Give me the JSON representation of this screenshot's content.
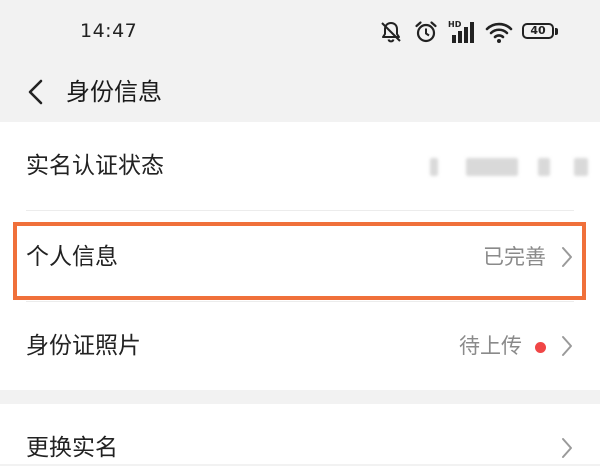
{
  "status_bar": {
    "time": "14:47",
    "battery_level": "40",
    "network_badge": "HD",
    "icons": [
      "bell-muted-icon",
      "alarm-icon",
      "signal-icon",
      "wifi-icon",
      "battery-icon"
    ]
  },
  "header": {
    "title": "身份信息"
  },
  "rows": [
    {
      "label": "实名认证状态",
      "value": ""
    },
    {
      "label": "个人信息",
      "value": "已完善"
    },
    {
      "label": "身份证照片",
      "value": "待上传"
    },
    {
      "label": "更换实名",
      "value": ""
    }
  ],
  "colors": {
    "highlight": "#f0703a",
    "red_dot": "#f04646",
    "value_text": "#8a8a8a"
  }
}
